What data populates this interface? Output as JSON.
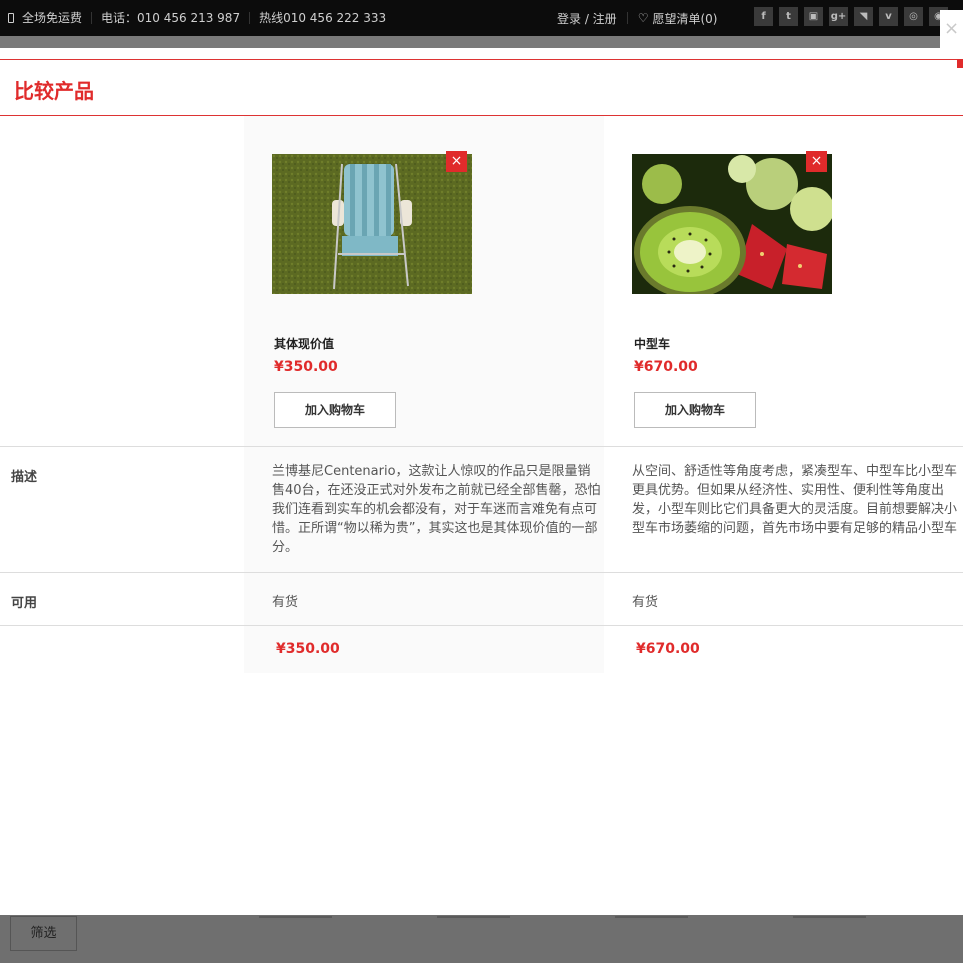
{
  "topbar": {
    "free_shipping": "全场免运费",
    "phone": "电话：010 456 213 987",
    "hotline": "热线010 456 222 333",
    "login": "登录 / 注册",
    "wishlist": "愿望清单(0)",
    "social_icons": [
      "facebook-icon",
      "twitter-icon",
      "flickr-icon",
      "googleplus-icon",
      "rss-icon",
      "vimeo-icon",
      "wechat-icon",
      "weibo-icon"
    ],
    "social_glyphs": [
      "f",
      "t",
      "▣",
      "g+",
      "◥",
      "v",
      "◎",
      "◉"
    ]
  },
  "modal": {
    "title": "比较产品",
    "close_symbol": "×",
    "remove_symbol": "×",
    "rows": {
      "description_label": "描述",
      "availability_label": "可用"
    },
    "products": [
      {
        "name": "其体现价值",
        "price": "¥350.00",
        "cart_label": "加入购物车",
        "description": "兰博基尼Centenario，这款让人惊叹的作品只是限量销售40台，在还没正式对外发布之前就已经全部售罄，恐怕我们连看到实车的机会都没有，对于车迷而言难免有点可惜。正所谓“物以稀为贵”，其实这也是其体现价值的一部分。",
        "availability": "有货",
        "image": "folding-chair"
      },
      {
        "name": "中型车",
        "price": "¥670.00",
        "cart_label": "加入购物车",
        "description": "从空间、舒适性等角度考虑，紧凑型车、中型车比小型车更具优势。但如果从经济性、实用性、便利性等角度出发，小型车则比它们具备更大的灵活度。目前想要解决小型车市场萎缩的问题，首先市场中要有足够的精品小型车",
        "availability": "有货",
        "image": "kiwi-fruit"
      }
    ]
  },
  "background": {
    "filter_label": "筛选"
  },
  "colors": {
    "accent": "#e02b2b",
    "topbar": "#0c0c0c"
  }
}
